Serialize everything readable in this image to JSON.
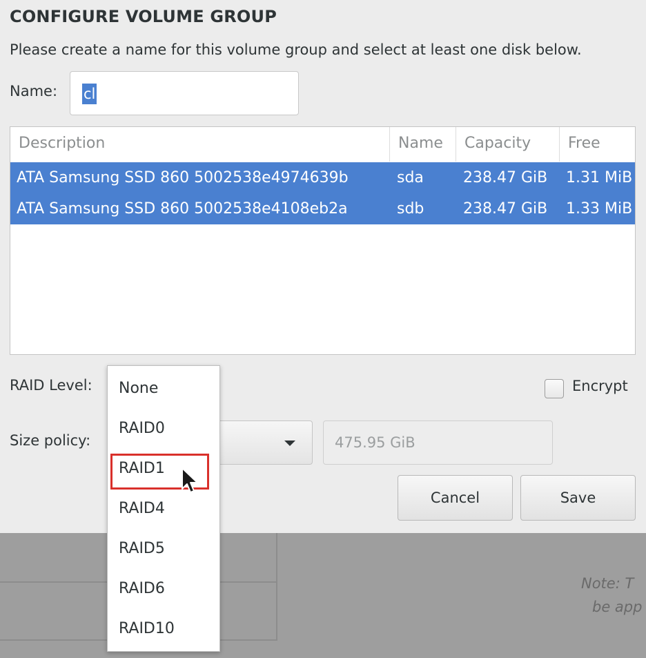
{
  "dialog": {
    "title": "CONFIGURE VOLUME GROUP",
    "subtitle": "Please create a name for this volume group and select at least one disk below.",
    "name_label": "Name:",
    "name_value": "cl"
  },
  "table": {
    "headers": {
      "description": "Description",
      "name": "Name",
      "capacity": "Capacity",
      "free": "Free"
    },
    "rows": [
      {
        "description": "ATA Samsung SSD 860 5002538e4974639b",
        "name": "sda",
        "capacity": "238.47 GiB",
        "free": "1.31 MiB",
        "selected": true
      },
      {
        "description": "ATA Samsung SSD 860 5002538e4108eb2a",
        "name": "sdb",
        "capacity": "238.47 GiB",
        "free": "1.33 MiB",
        "selected": true
      }
    ]
  },
  "raid": {
    "label": "RAID Level:",
    "options": [
      "None",
      "RAID0",
      "RAID1",
      "RAID4",
      "RAID5",
      "RAID6",
      "RAID10"
    ],
    "hovered": "RAID1"
  },
  "encrypt": {
    "label": "Encrypt",
    "checked": false
  },
  "size_policy": {
    "label": "Size policy:",
    "size_value": "475.95 GiB"
  },
  "buttons": {
    "cancel": "Cancel",
    "save": "Save"
  },
  "background": {
    "note_line1": "Note: T",
    "note_line2": "be app"
  },
  "colors": {
    "selection": "#4a80d0",
    "highlight_box": "#d9302b",
    "dim_background": "#9e9e9e"
  },
  "icons": {
    "combo_arrow": "chevron-down-icon",
    "cursor": "mouse-pointer-icon",
    "checkbox": "checkbox-icon"
  }
}
